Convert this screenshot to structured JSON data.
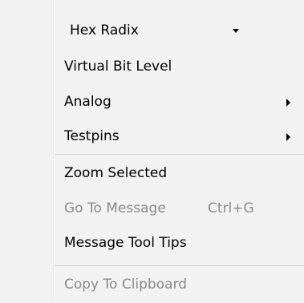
{
  "menu": {
    "radix_select": {
      "value": "Hex Radix"
    },
    "items": [
      {
        "label": "Virtual Bit Level"
      },
      {
        "label": "Analog"
      },
      {
        "label": "Testpins"
      },
      {
        "label": "Zoom Selected"
      },
      {
        "label": "Go To Message",
        "shortcut": "Ctrl+G"
      },
      {
        "label": "Message Tool Tips"
      },
      {
        "label": "Copy To Clipboard"
      }
    ]
  }
}
